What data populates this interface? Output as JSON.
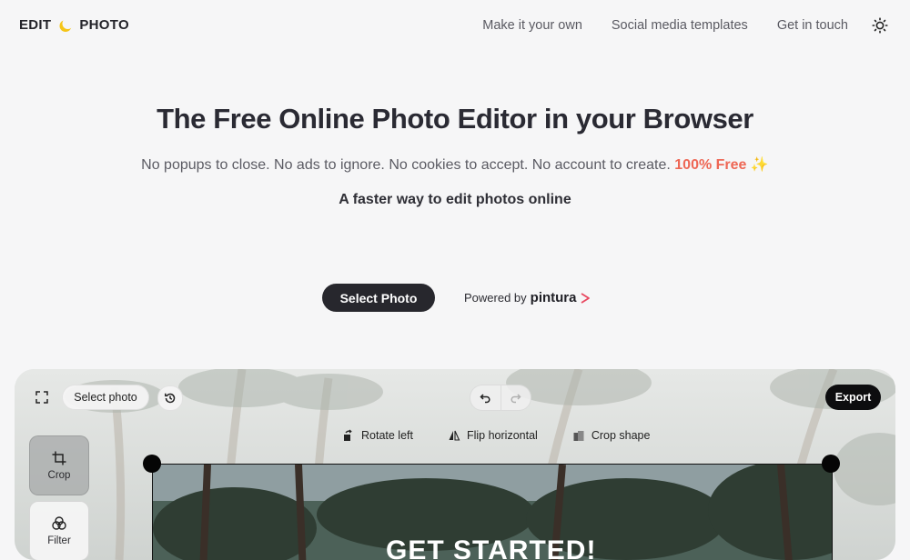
{
  "header": {
    "logo_left": "EDIT",
    "logo_right": "PHOTO",
    "nav": [
      "Make it your own",
      "Social media templates",
      "Get in touch"
    ],
    "theme_icon": "sun-icon"
  },
  "hero": {
    "title": "The Free Online Photo Editor in your Browser",
    "subtitle": "No popups to close. No ads to ignore. No cookies to accept. No account to create.",
    "free_label": "100% Free",
    "sparkle": "✨",
    "tagline": "A faster way to edit photos online",
    "select_button": "Select Photo",
    "powered_by": "Powered by",
    "powered_brand": "pintura"
  },
  "editor": {
    "fullscreen_icon": "fullscreen-icon",
    "select_photo": "Select photo",
    "history_icon": "history-icon",
    "undo_icon": "undo-icon",
    "redo_icon": "redo-icon",
    "export": "Export",
    "tools": [
      {
        "label": "Crop",
        "icon": "crop-icon",
        "active": true
      },
      {
        "label": "Filter",
        "icon": "filter-icon",
        "active": false
      }
    ],
    "subtools": [
      {
        "label": "Rotate left",
        "icon": "rotate-left-icon"
      },
      {
        "label": "Flip horizontal",
        "icon": "flip-horizontal-icon"
      },
      {
        "label": "Crop shape",
        "icon": "crop-shape-icon"
      }
    ],
    "image_text": "GET STARTED!"
  },
  "colors": {
    "accent_free": "#ee6755",
    "dark_button": "#27272d",
    "logo_sun": "#f5c518"
  }
}
